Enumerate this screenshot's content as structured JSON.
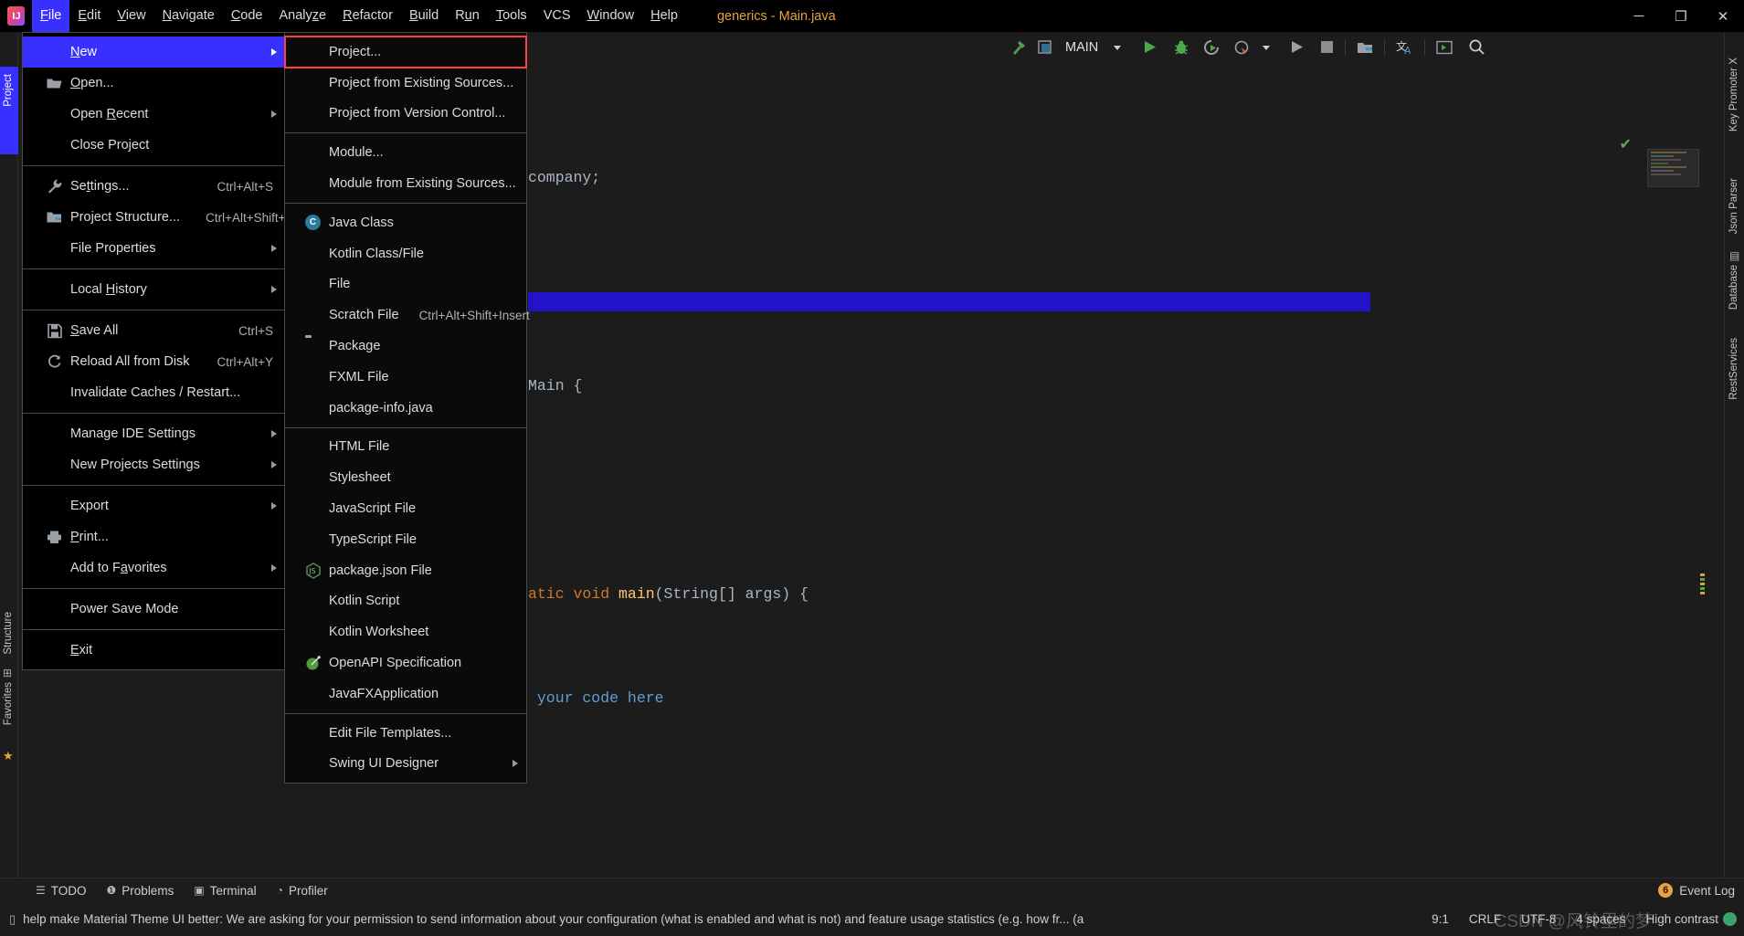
{
  "window": {
    "title": "generics - Main.java",
    "app_icon": "intellij-idea-logo",
    "controls": {
      "minimize": "─",
      "maximize": "❐",
      "close": "✕"
    }
  },
  "menubar": {
    "items": [
      {
        "label": "File",
        "mnemonic": "F",
        "active": true
      },
      {
        "label": "Edit",
        "mnemonic": "E",
        "active": false
      },
      {
        "label": "View",
        "mnemonic": "V",
        "active": false
      },
      {
        "label": "Navigate",
        "mnemonic": "N",
        "active": false
      },
      {
        "label": "Code",
        "mnemonic": "C",
        "active": false
      },
      {
        "label": "Analyze",
        "mnemonic": "z",
        "active": false
      },
      {
        "label": "Refactor",
        "mnemonic": "R",
        "active": false
      },
      {
        "label": "Build",
        "mnemonic": "B",
        "active": false
      },
      {
        "label": "Run",
        "mnemonic": "u",
        "active": false
      },
      {
        "label": "Tools",
        "mnemonic": "T",
        "active": false
      },
      {
        "label": "VCS",
        "mnemonic": "",
        "active": false
      },
      {
        "label": "Window",
        "mnemonic": "W",
        "active": false
      },
      {
        "label": "Help",
        "mnemonic": "H",
        "active": false
      }
    ]
  },
  "toolbar": {
    "build_icon": "hammer-icon",
    "select_target_icon": "stack-window-icon",
    "run_configuration": "MAIN",
    "dropdown_icon": "chevron-down-icon",
    "run_icon": "run-triangle-icon",
    "debug_icon": "debug-bug-icon",
    "run_coverage_icon": "run-with-coverage-icon",
    "profiler_icon": "profiler-clock-icon",
    "profiler_dropdown_icon": "chevron-down-icon",
    "run_anything_icon": "run-gray-triangle-icon",
    "stop_icon": "stop-square-icon",
    "project_structure_icon": "project-structure-icon",
    "translate_icon": "translate-icon",
    "terminal_icon": "terminal-icon",
    "search_icon": "search-icon"
  },
  "left_rail": {
    "project_tab": "Project",
    "items": [
      "Structure",
      "Favorites"
    ]
  },
  "right_rail": {
    "items": [
      "Key Promoter X",
      "Json Parser",
      "Database",
      "RestServices"
    ]
  },
  "file_menu": {
    "groups": [
      [
        {
          "label": "New",
          "mnemonic": "N",
          "icon": "",
          "accel": "",
          "submenu": true,
          "highlighted": true
        },
        {
          "label": "Open...",
          "mnemonic": "O",
          "icon": "open-folder-icon",
          "accel": "",
          "submenu": false,
          "highlighted": false
        },
        {
          "label": "Open Recent",
          "mnemonic": "R",
          "icon": "",
          "accel": "",
          "submenu": true,
          "highlighted": false
        },
        {
          "label": "Close Project",
          "mnemonic": "",
          "icon": "",
          "accel": "",
          "submenu": false,
          "highlighted": false
        }
      ],
      [
        {
          "label": "Settings...",
          "mnemonic": "t",
          "icon": "wrench-icon",
          "accel": "Ctrl+Alt+S",
          "submenu": false,
          "highlighted": false
        },
        {
          "label": "Project Structure...",
          "mnemonic": "",
          "icon": "project-structure-icon",
          "accel": "Ctrl+Alt+Shift+S",
          "submenu": false,
          "highlighted": false
        },
        {
          "label": "File Properties",
          "mnemonic": "",
          "icon": "",
          "accel": "",
          "submenu": true,
          "highlighted": false
        }
      ],
      [
        {
          "label": "Local History",
          "mnemonic": "H",
          "icon": "",
          "accel": "",
          "submenu": true,
          "highlighted": false
        }
      ],
      [
        {
          "label": "Save All",
          "mnemonic": "S",
          "icon": "save-icon",
          "accel": "Ctrl+S",
          "submenu": false,
          "highlighted": false
        },
        {
          "label": "Reload All from Disk",
          "mnemonic": "",
          "icon": "reload-icon",
          "accel": "Ctrl+Alt+Y",
          "submenu": false,
          "highlighted": false
        },
        {
          "label": "Invalidate Caches / Restart...",
          "mnemonic": "",
          "icon": "",
          "accel": "",
          "submenu": false,
          "highlighted": false
        }
      ],
      [
        {
          "label": "Manage IDE Settings",
          "mnemonic": "",
          "icon": "",
          "accel": "",
          "submenu": true,
          "highlighted": false
        },
        {
          "label": "New Projects Settings",
          "mnemonic": "",
          "icon": "",
          "accel": "",
          "submenu": true,
          "highlighted": false
        }
      ],
      [
        {
          "label": "Export",
          "mnemonic": "",
          "icon": "",
          "accel": "",
          "submenu": true,
          "highlighted": false
        },
        {
          "label": "Print...",
          "mnemonic": "P",
          "icon": "print-icon",
          "accel": "",
          "submenu": false,
          "highlighted": false
        },
        {
          "label": "Add to Favorites",
          "mnemonic": "a",
          "icon": "",
          "accel": "",
          "submenu": true,
          "highlighted": false
        }
      ],
      [
        {
          "label": "Power Save Mode",
          "mnemonic": "",
          "icon": "",
          "accel": "",
          "submenu": false,
          "highlighted": false
        }
      ],
      [
        {
          "label": "Exit",
          "mnemonic": "E",
          "icon": "",
          "accel": "",
          "submenu": false,
          "highlighted": false
        }
      ]
    ]
  },
  "new_submenu": {
    "groups": [
      [
        {
          "label": "Project...",
          "icon": "",
          "accel": "",
          "submenu": false,
          "boxed": true
        },
        {
          "label": "Project from Existing Sources...",
          "icon": "",
          "accel": "",
          "submenu": false,
          "boxed": false
        },
        {
          "label": "Project from Version Control...",
          "icon": "",
          "accel": "",
          "submenu": false,
          "boxed": false
        }
      ],
      [
        {
          "label": "Module...",
          "icon": "",
          "accel": "",
          "submenu": false,
          "boxed": false
        },
        {
          "label": "Module from Existing Sources...",
          "icon": "",
          "accel": "",
          "submenu": false,
          "boxed": false
        }
      ],
      [
        {
          "label": "Java Class",
          "icon": "java-class-icon",
          "accel": "",
          "submenu": false,
          "boxed": false
        },
        {
          "label": "Kotlin Class/File",
          "icon": "kotlin-file-icon",
          "accel": "",
          "submenu": false,
          "boxed": false
        },
        {
          "label": "File",
          "icon": "file-icon",
          "accel": "",
          "submenu": false,
          "boxed": false
        },
        {
          "label": "Scratch File",
          "icon": "scratch-file-icon",
          "accel": "Ctrl+Alt+Shift+Insert",
          "submenu": false,
          "boxed": false
        },
        {
          "label": "Package",
          "icon": "package-folder-icon",
          "accel": "",
          "submenu": false,
          "boxed": false
        },
        {
          "label": "FXML File",
          "icon": "fxml-file-icon",
          "accel": "",
          "submenu": false,
          "boxed": false
        },
        {
          "label": "package-info.java",
          "icon": "java-file-icon",
          "accel": "",
          "submenu": false,
          "boxed": false
        }
      ],
      [
        {
          "label": "HTML File",
          "icon": "html-file-icon",
          "accel": "",
          "submenu": false,
          "boxed": false
        },
        {
          "label": "Stylesheet",
          "icon": "css-file-icon",
          "accel": "",
          "submenu": false,
          "boxed": false
        },
        {
          "label": "JavaScript File",
          "icon": "js-file-icon",
          "accel": "",
          "submenu": false,
          "boxed": false
        },
        {
          "label": "TypeScript File",
          "icon": "ts-file-icon",
          "accel": "",
          "submenu": false,
          "boxed": false
        },
        {
          "label": "package.json File",
          "icon": "nodejs-icon",
          "accel": "",
          "submenu": false,
          "boxed": false
        },
        {
          "label": "Kotlin Script",
          "icon": "kotlin-script-icon",
          "accel": "",
          "submenu": false,
          "boxed": false
        },
        {
          "label": "Kotlin Worksheet",
          "icon": "kotlin-worksheet-icon",
          "accel": "",
          "submenu": false,
          "boxed": false
        },
        {
          "label": "OpenAPI Specification",
          "icon": "openapi-icon",
          "accel": "",
          "submenu": false,
          "boxed": false
        },
        {
          "label": "JavaFXApplication",
          "icon": "java-file-icon",
          "accel": "",
          "submenu": false,
          "boxed": false
        }
      ],
      [
        {
          "label": "Edit File Templates...",
          "icon": "",
          "accel": "",
          "submenu": false,
          "boxed": false
        },
        {
          "label": "Swing UI Designer",
          "icon": "",
          "accel": "",
          "submenu": true,
          "boxed": false
        }
      ]
    ]
  },
  "editor": {
    "lines": [
      {
        "segments": [
          {
            "t": "company;",
            "c": "pun"
          }
        ]
      },
      {
        "segments": []
      },
      {
        "segments": [
          {
            "t": "Main {",
            "c": "cls"
          }
        ]
      },
      {
        "segments": []
      },
      {
        "segments": [
          {
            "t": "atic ",
            "c": "k"
          },
          {
            "t": "void ",
            "c": "k"
          },
          {
            "t": "main",
            "c": "fn"
          },
          {
            "t": "(String[] args) {",
            "c": "pun"
          }
        ]
      },
      {
        "segments": [
          {
            "t": " your code here",
            "c": "com-blue"
          }
        ]
      }
    ],
    "inspection_ok_icon": "green-check-icon"
  },
  "bottom_bar": {
    "items": [
      {
        "label": "TODO",
        "icon": "todo-list-icon"
      },
      {
        "label": "Problems",
        "icon": "problems-icon"
      },
      {
        "label": "Terminal",
        "icon": "terminal-icon"
      },
      {
        "label": "Profiler",
        "icon": "profiler-icon"
      }
    ],
    "event_log": {
      "label": "Event Log",
      "count": "6"
    }
  },
  "status_bar": {
    "message_icon": "notification-icon",
    "message": "help make Material Theme UI better: We are asking for your permission to send information about your configuration (what is enabled and what is not) and feature usage statistics (e.g. how fr... (a minute ago)",
    "caret": "9:1",
    "line_separator": "CRLF",
    "encoding": "UTF-8",
    "indent": "4 spaces",
    "high_contrast": "High contrast",
    "watermark": "CSDN @风铃里的梦"
  },
  "colors": {
    "accent_blue": "#3730ff",
    "menu_bg": "#000000",
    "panel_bg": "#1c1c1c",
    "highlight_box": "#ff4040",
    "title_doc": "#e8a33d",
    "keyword": "#cc7832",
    "method": "#ffc66d",
    "comment_blue": "#5f9fd6"
  }
}
